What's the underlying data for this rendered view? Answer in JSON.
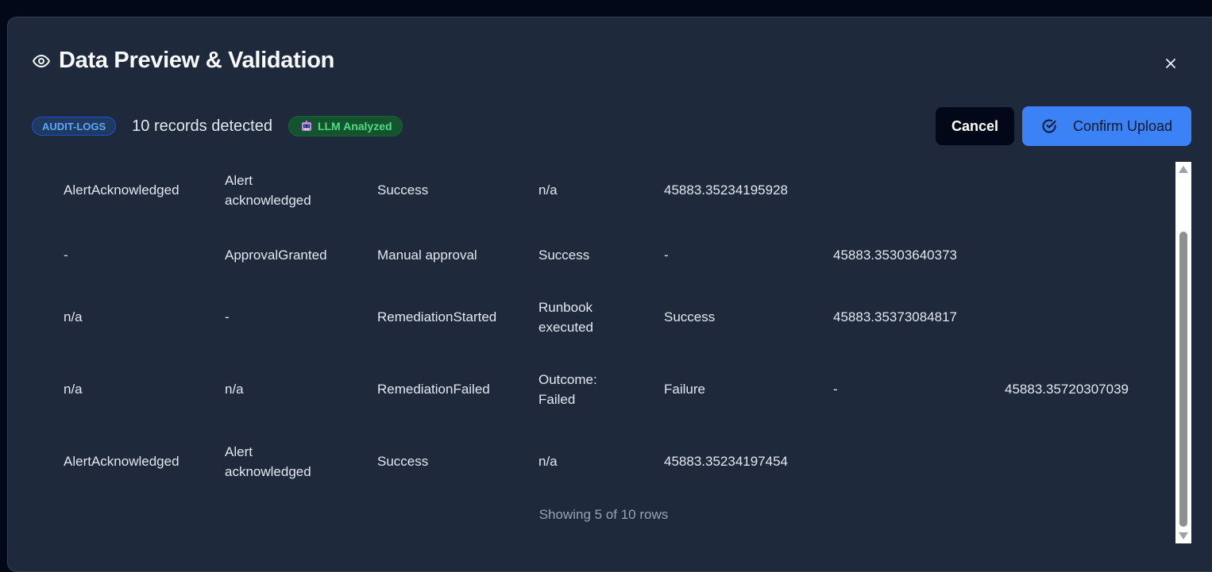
{
  "dialog": {
    "title": "Data Preview & Validation",
    "type_badge": "AUDIT-LOGS",
    "records_text": "10 records detected",
    "llm_badge": "LLM Analyzed",
    "cancel_label": "Cancel",
    "confirm_label": "Confirm Upload",
    "footer": "Showing 5 of 10 rows"
  },
  "rows": [
    [
      "AlertAcknowledged",
      "Alert\nacknowledged",
      "Success",
      "n/a",
      "45883.35234195928"
    ],
    [
      "-",
      "ApprovalGranted",
      "Manual approval",
      "Success",
      "-",
      "45883.35303640373"
    ],
    [
      "n/a",
      "-",
      "RemediationStarted",
      "Runbook\nexecuted",
      "Success",
      "45883.35373084817"
    ],
    [
      "n/a",
      "n/a",
      "RemediationFailed",
      "Outcome:\nFailed",
      "Failure",
      "-",
      "45883.35720307039"
    ],
    [
      "AlertAcknowledged",
      "Alert\nacknowledged",
      "Success",
      "n/a",
      "45883.35234197454"
    ]
  ],
  "colors": {
    "modal_bg": "#1e293b",
    "accent": "#3b82f6",
    "badge_blue": "#60a5fa",
    "badge_green": "#4ade80"
  },
  "icons": [
    "eye-icon",
    "close-icon",
    "robot-icon",
    "check-circle-icon"
  ]
}
